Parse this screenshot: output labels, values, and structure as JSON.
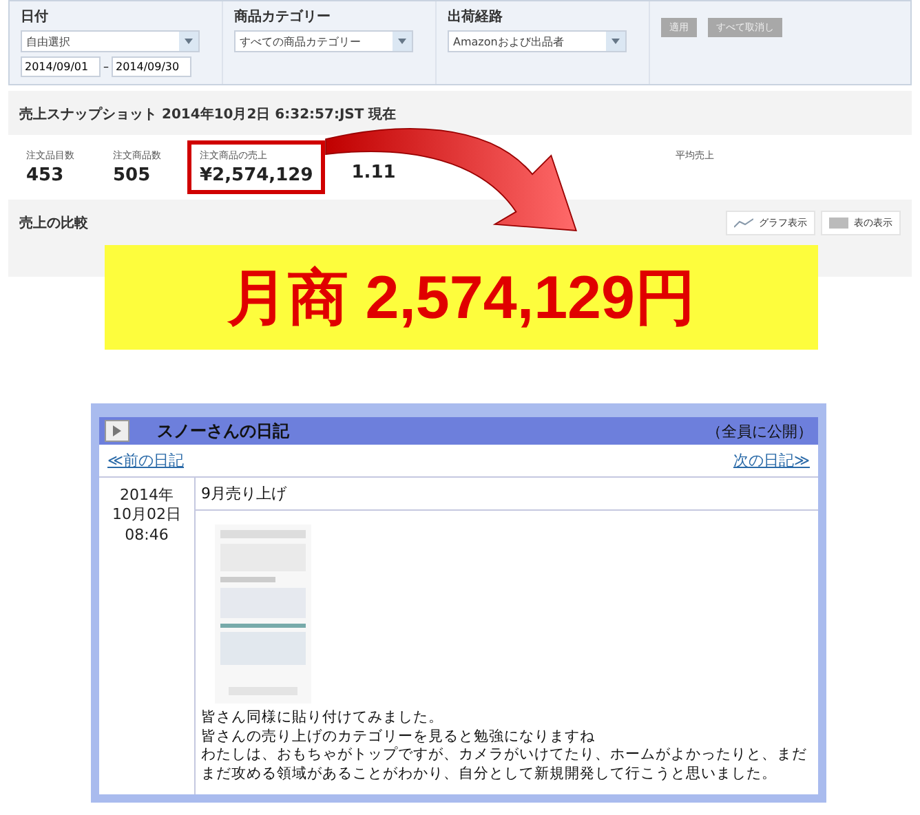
{
  "filters": [
    {
      "label": "日付",
      "dropdown": "自由選択",
      "dates": [
        "2014/09/01",
        "2014/09/30"
      ],
      "separator": "–"
    },
    {
      "label": "商品カテゴリー",
      "dropdown": "すべての商品カテゴリー"
    },
    {
      "label": "出荷経路",
      "dropdown": "Amazonおよび出品者"
    }
  ],
  "filter_buttons": [
    {
      "label": "適用",
      "disabled": true
    },
    {
      "label": "すべて取消し",
      "disabled": true
    }
  ],
  "snapshot": {
    "title": "売上スナップショット 2014年10月2日 6:32:57:JST 現在",
    "metrics": [
      {
        "label": "注文品目数",
        "value": "453",
        "highlighted": false
      },
      {
        "label": "注文商品数",
        "value": "505",
        "highlighted": false
      },
      {
        "label": "注文商品の売上",
        "value": "¥2,574,129",
        "highlighted": true
      },
      {
        "value": "1.11",
        "highlighted": false
      },
      {
        "label": "平均売上",
        "highlighted": false
      }
    ]
  },
  "comparison": {
    "title": "売上の比較",
    "views": [
      {
        "label": "グラフ表示",
        "kind": "graph"
      },
      {
        "label": "表の表示",
        "kind": "table"
      }
    ]
  },
  "banner": {
    "text": "月商 2,574,129円"
  },
  "diary": {
    "title": "スノーさんの日記",
    "visibility": "（全員に公開）",
    "prev": "≪前の日記",
    "next": "次の日記≫",
    "date": [
      "2014年",
      "10月02日",
      "08:46"
    ],
    "entry_title": "9月売り上げ",
    "body": [
      "皆さん同様に貼り付けてみました。",
      "皆さんの売り上げのカテゴリーを見ると勉強になりますね",
      "わたしは、おもちゃがトップですが、カメラがいけてたり、ホームがよかったりと、まだまだ攻める領域があることがわかり、自分として新規開発して行こうと思いました。"
    ]
  }
}
